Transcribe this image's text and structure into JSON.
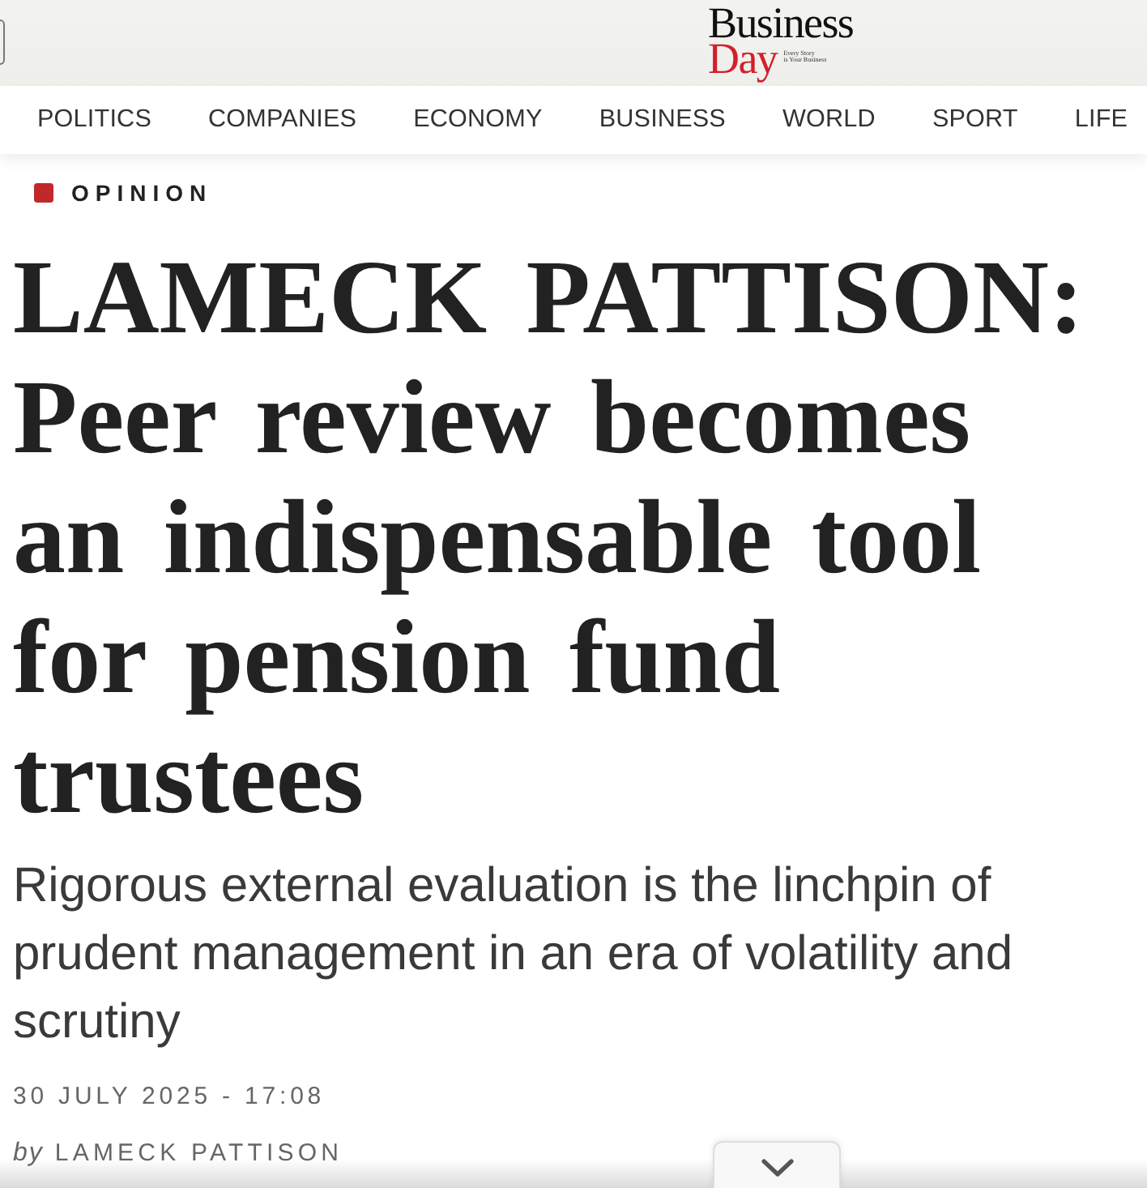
{
  "header": {
    "logo": {
      "line_1": "Business",
      "line_2": "Day",
      "tagline": [
        "Every Story",
        "is Your Business"
      ]
    }
  },
  "nav": {
    "items": [
      "POLITICS",
      "COMPANIES",
      "ECONOMY",
      "BUSINESS",
      "WORLD",
      "SPORT",
      "LIFE"
    ]
  },
  "article": {
    "category": "OPINION",
    "headline": "LAMECK PATTISON: Peer review becomes an indispensable tool for pension fund trustees",
    "standfirst": "Rigorous external evaluation is the linchpin of prudent management in an era of volatility and scrutiny",
    "date": "30 JULY 2025 - 17:08",
    "byline": {
      "prefix": "by",
      "author": "LAMECK PATTISON"
    }
  }
}
